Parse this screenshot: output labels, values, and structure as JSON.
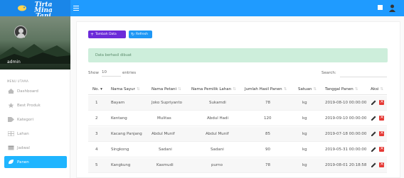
{
  "brand": {
    "name_line1": "Tirta Mina",
    "name_line2": "Tani"
  },
  "user": {
    "name": "admin"
  },
  "menu": {
    "title": "MENU UTAMA",
    "items": [
      {
        "label": "Dashboard",
        "icon": "dashboard-icon"
      },
      {
        "label": "Best Produk",
        "icon": "star-icon"
      },
      {
        "label": "Kategori",
        "icon": "tag-icon"
      },
      {
        "label": "Lahan",
        "icon": "table-icon"
      },
      {
        "label": "Jadwal",
        "icon": "calendar-icon"
      },
      {
        "label": "Panen",
        "icon": "leaf-icon",
        "active": true
      }
    ]
  },
  "toolbar": {
    "add_label": "Tambah Data",
    "refresh_label": "Refresh"
  },
  "alert": {
    "message": "Data berhasil dibuat"
  },
  "table_controls": {
    "show_label": "Show",
    "show_value": "10",
    "entries_label": "entries",
    "search_label": "Search:"
  },
  "table": {
    "columns": [
      "No.",
      "Nama Sayur",
      "Nama Petani",
      "Nama Pemilik Lahan",
      "Jumlah Hasil Panen",
      "Satuan",
      "Tanggal Panen",
      "Aksi"
    ],
    "rows": [
      {
        "no": "1",
        "sayur": "Bayam",
        "petani": "Joko Supriyanto",
        "pemilik": "Sukamdi",
        "jumlah": "78",
        "satuan": "kg",
        "tanggal": "2019-08-10 00:00:00"
      },
      {
        "no": "2",
        "sayur": "Kentang",
        "petani": "Mulitas",
        "pemilik": "Abdul Hadi",
        "jumlah": "120",
        "satuan": "kg",
        "tanggal": "2019-09-10 00:00:00"
      },
      {
        "no": "3",
        "sayur": "Kacang Panjang",
        "petani": "Abdul Munif",
        "pemilik": "Abdul Munif",
        "jumlah": "85",
        "satuan": "kg",
        "tanggal": "2019-07-18 00:00:00"
      },
      {
        "no": "4",
        "sayur": "Singkong",
        "petani": "Sadani",
        "pemilik": "Sadani",
        "jumlah": "90",
        "satuan": "kg",
        "tanggal": "2019-05-31 00:00:00"
      },
      {
        "no": "5",
        "sayur": "Kangkung",
        "petani": "Kasmudi",
        "pemilik": "purno",
        "jumlah": "78",
        "satuan": "kg",
        "tanggal": "2019-08-01 20:18:58"
      }
    ]
  },
  "colors": {
    "topbar": "#1f9bff",
    "logo_bg": "#1a86e8",
    "add_button": "#6c2bd9",
    "refresh_button": "#1e97f5",
    "alert_bg": "#cdeedb",
    "active_menu": "#1fb5ff",
    "delete": "#e53935"
  }
}
